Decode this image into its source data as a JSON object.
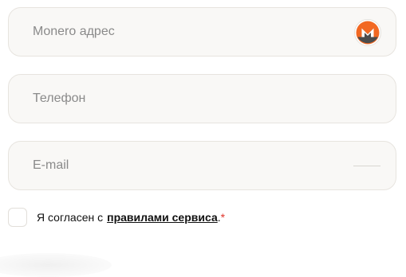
{
  "form": {
    "monero_field": {
      "placeholder": "Monero адрес",
      "value": "",
      "icon": "monero-logo-icon"
    },
    "phone_field": {
      "placeholder": "Телефон",
      "value": ""
    },
    "email_field": {
      "placeholder": "E-mail",
      "value": ""
    },
    "agreement": {
      "prefix": "Я согласен с",
      "link_text": "правилами сервиса",
      "suffix": ".",
      "required_mark": "*",
      "checked": false
    }
  },
  "colors": {
    "field_bg": "#f9f8f6",
    "field_border": "#e7e4df",
    "monero_orange": "#f26822",
    "monero_gray": "#4c4c4c",
    "required": "#e0342a"
  }
}
